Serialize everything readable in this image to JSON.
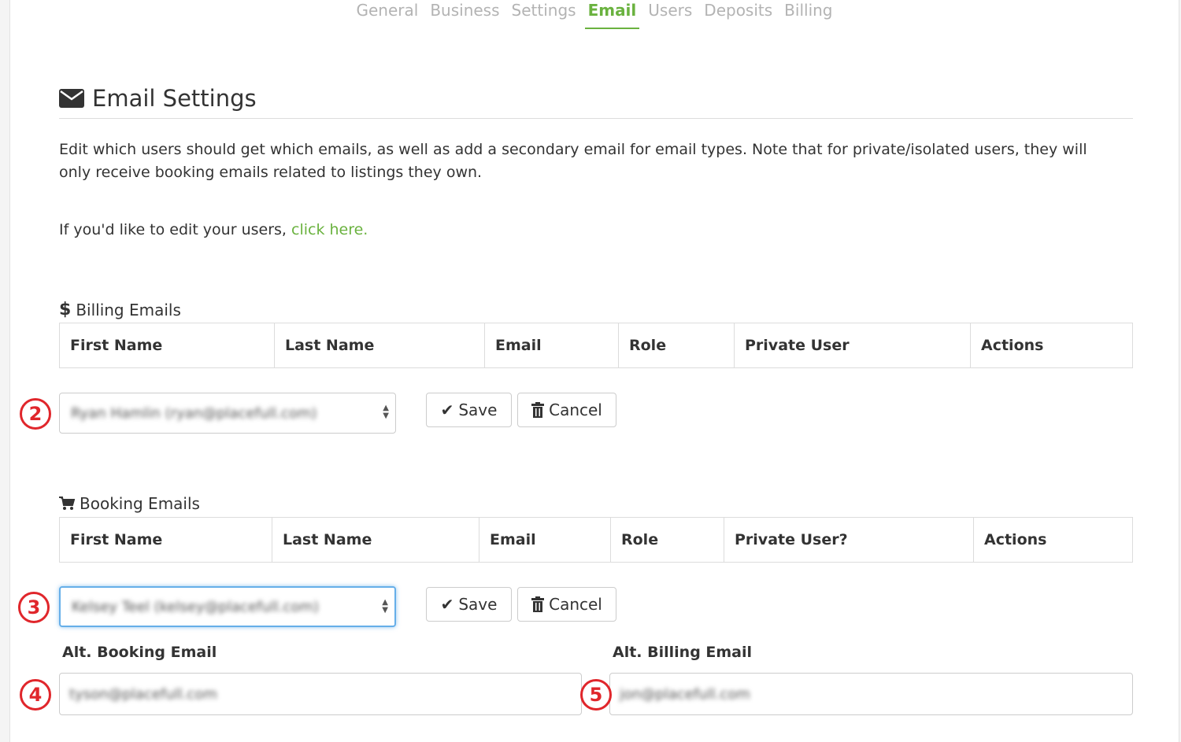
{
  "tabs": [
    {
      "label": "General",
      "active": false
    },
    {
      "label": "Business",
      "active": false
    },
    {
      "label": "Settings",
      "active": false
    },
    {
      "label": "Email",
      "active": true
    },
    {
      "label": "Users",
      "active": false
    },
    {
      "label": "Deposits",
      "active": false
    },
    {
      "label": "Billing",
      "active": false
    }
  ],
  "page": {
    "title": "Email Settings",
    "description": "Edit which users should get which emails, as well as add a secondary email for email types. Note that for private/isolated users, they will only receive booking emails related to listings they own.",
    "edit_users_prefix": "If you'd like to edit your users, ",
    "edit_users_link": "click here."
  },
  "billing": {
    "label": "Billing Emails",
    "columns": [
      "First Name",
      "Last Name",
      "Email",
      "Role",
      "Private User",
      "Actions"
    ],
    "selected_user": "Ryan Hamlin (ryan@placefull.com)",
    "save": "Save",
    "cancel": "Cancel"
  },
  "booking": {
    "label": "Booking Emails",
    "columns": [
      "First Name",
      "Last Name",
      "Email",
      "Role",
      "Private User?",
      "Actions"
    ],
    "selected_user": "Kelsey Teel (kelsey@placefull.com)",
    "save": "Save",
    "cancel": "Cancel",
    "alt_booking_label": "Alt. Booking Email",
    "alt_booking_value": "tyson@placefull.com",
    "alt_billing_label": "Alt. Billing Email",
    "alt_billing_value": "jon@placefull.com"
  },
  "markers": [
    "2",
    "3",
    "4",
    "5"
  ],
  "colors": {
    "accent": "#6ab23f",
    "marker": "#e0262b",
    "focus": "#66afe9"
  }
}
